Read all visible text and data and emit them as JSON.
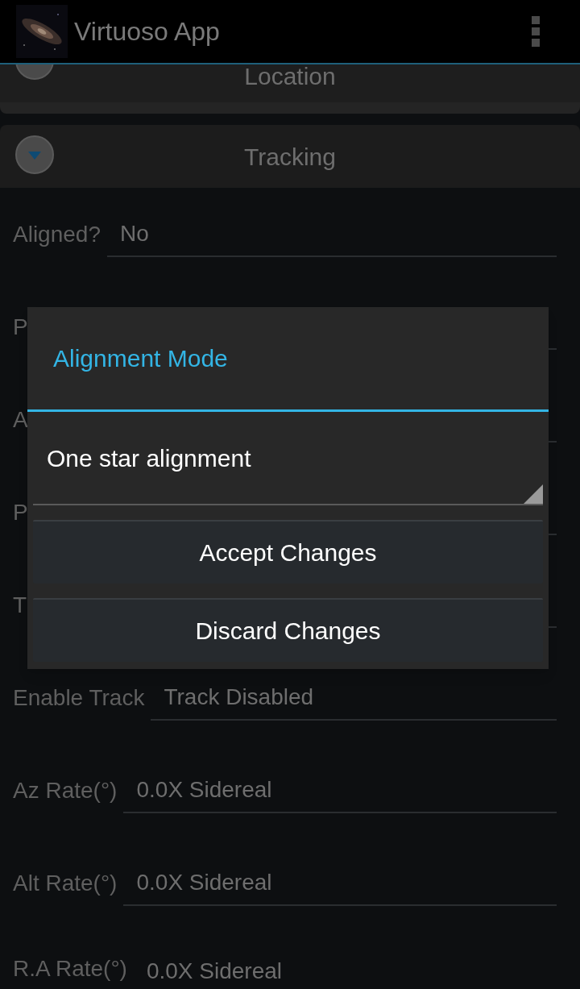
{
  "app_bar": {
    "title": "Virtuoso App"
  },
  "sections": [
    {
      "title": "Location"
    },
    {
      "title": "Tracking"
    }
  ],
  "fields": [
    {
      "label": "Aligned?",
      "value": "No"
    },
    {
      "label": "P"
    },
    {
      "label": "A"
    },
    {
      "label": "P"
    },
    {
      "label": "T"
    },
    {
      "label": "Enable Track",
      "value": "Track Disabled"
    },
    {
      "label": "Az Rate(°)",
      "value": "0.0X Sidereal"
    },
    {
      "label": "Alt Rate(°)",
      "value": "0.0X Sidereal"
    },
    {
      "label": "R.A Rate(°)",
      "value": "0.0X Sidereal"
    }
  ],
  "dialog": {
    "title": "Alignment Mode",
    "spinner": {
      "value": "One star alignment"
    },
    "buttons": [
      "Accept Changes",
      "Discard Changes"
    ]
  }
}
